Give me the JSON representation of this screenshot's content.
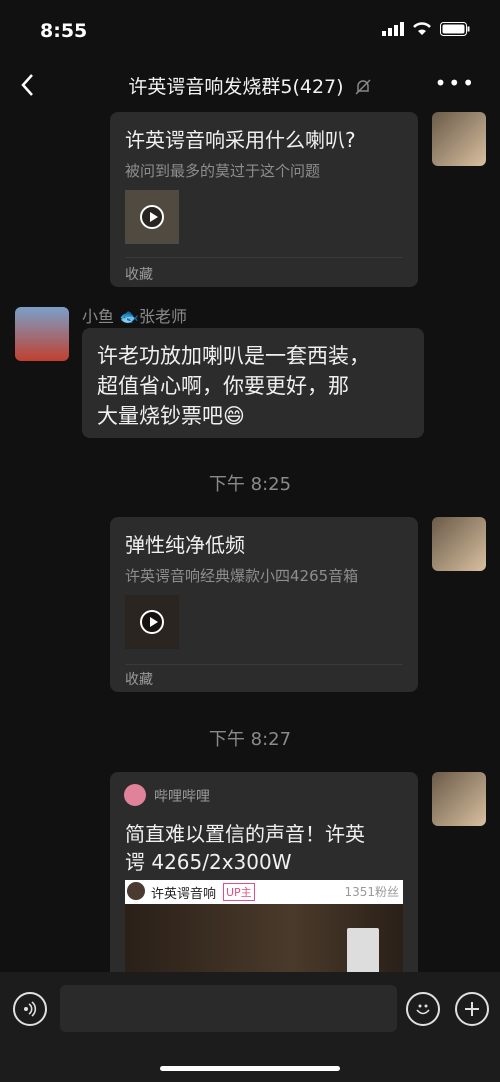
{
  "status": {
    "time": "8:55"
  },
  "nav": {
    "title": "许英谔音响发烧群5(427)"
  },
  "messages": {
    "card1": {
      "title": "许英谔音响采用什么喇叭?",
      "subtitle": "被问到最多的莫过于这个问题",
      "footer": "收藏"
    },
    "msg2": {
      "sender": "小鱼 🐟张老师",
      "text_line1": "许老功放加喇叭是一套西装，",
      "text_line2": "超值省心啊，你要更好，那",
      "text_line3": "大量烧钞票吧😄"
    },
    "sep1": "下午 8:25",
    "card2": {
      "title": "弹性纯净低频",
      "subtitle": "许英谔音响经典爆款小四4265音箱",
      "footer": "收藏"
    },
    "sep2": "下午 8:27",
    "card3": {
      "source": "哔哩哔哩",
      "title_line1": "简直难以置信的声音！许英",
      "title_line2": "谔 4265/2x300W",
      "channel": "许英谔音响",
      "badge": "UP主",
      "fans": "1351粉丝"
    }
  }
}
